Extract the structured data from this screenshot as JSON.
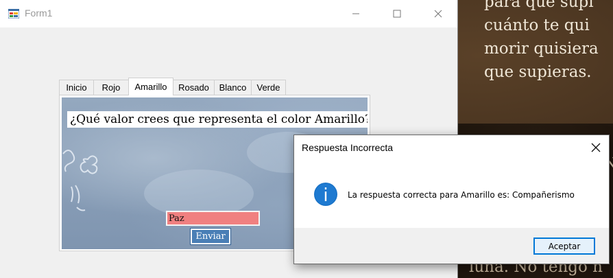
{
  "background": {
    "poem_lines": [
      "para que supi",
      "cuánto te qui",
      "morir quisiera",
      "que supieras."
    ],
    "bottom_line": "luna. No tengo n",
    "side_letter": "N"
  },
  "form": {
    "title": "Form1",
    "icon": "winforms-app-icon",
    "tabs": [
      {
        "label": "Inicio",
        "active": false
      },
      {
        "label": "Rojo",
        "active": false
      },
      {
        "label": "Amarillo",
        "active": true
      },
      {
        "label": "Rosado",
        "active": false
      },
      {
        "label": "Blanco",
        "active": false
      },
      {
        "label": "Verde",
        "active": false
      }
    ],
    "question": "¿Qué valor crees que representa el color Amarillo?",
    "answer_value": "Paz",
    "submit_label": "Enviar",
    "colors": {
      "answer_bg": "#f08080",
      "submit_bg": "#4a7fb6"
    }
  },
  "dialog": {
    "title": "Respuesta Incorrecta",
    "icon": "info-icon",
    "message": "La respuesta correcta para Amarillo es: Compañerismo",
    "ok_label": "Aceptar",
    "accent": "#0078d7"
  }
}
